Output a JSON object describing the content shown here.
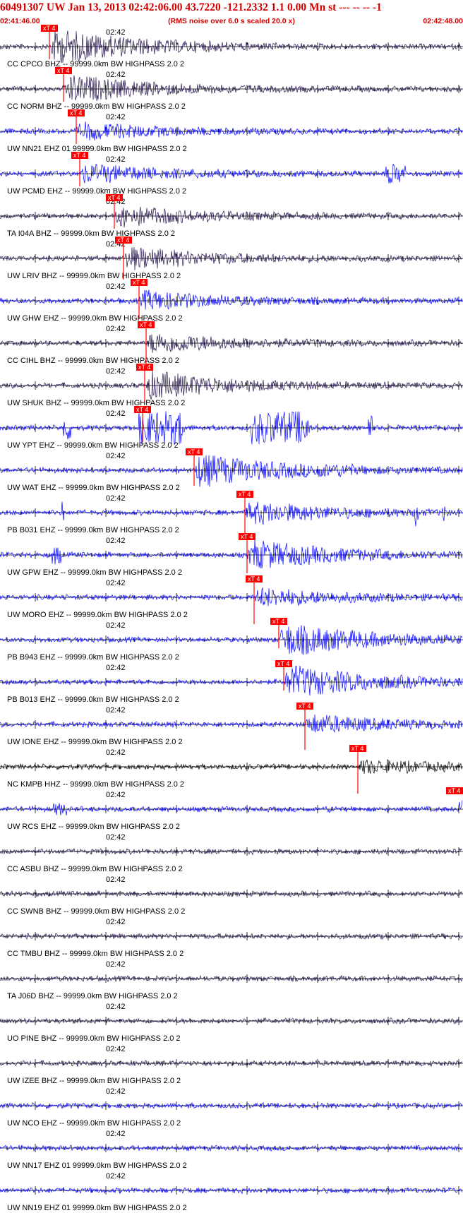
{
  "header": {
    "title": "60491307 UW Jan 13, 2013 02:42:06.00   43.7220 -121.2332  1.1 0.00 Mn st --- -- --  -1",
    "subtitle": "(RMS noise over 6.0 s scaled 20.0 x)",
    "start_time": "02:41:46.00",
    "end_time": "02:42:48.00",
    "title_color": "#d40000"
  },
  "tick_label": "02:42",
  "pick_label": "xT 4",
  "colors": {
    "pick": "#ff0000",
    "blue": "#0000ff",
    "dark": "#21104a",
    "black": "#000000"
  },
  "channels": [
    {
      "label": "CC CPCO BHZ -- 99999.0km BW  HIGHPASS  2.0  2",
      "color": "dark"
    },
    {
      "label": "CC NORM BHZ -- 99999.0km BW  HIGHPASS  2.0  2",
      "color": "dark"
    },
    {
      "label": "UW NN21 EHZ 01 99999.0km BW  HIGHPASS  2.0  2",
      "color": "blue"
    },
    {
      "label": "UW PCMD EHZ -- 99999.0km BW  HIGHPASS  2.0  2",
      "color": "blue"
    },
    {
      "label": "TA I04A BHZ -- 99999.0km BW  HIGHPASS  2.0  2",
      "color": "dark"
    },
    {
      "label": "UW LRIV BHZ -- 99999.0km BW  HIGHPASS  2.0  2",
      "color": "dark"
    },
    {
      "label": "UW GHW EHZ -- 99999.0km BW  HIGHPASS  2.0  2",
      "color": "blue"
    },
    {
      "label": "CC CIHL BHZ -- 99999.0km BW  HIGHPASS  2.0  2",
      "color": "dark"
    },
    {
      "label": "UW SHUK BHZ -- 99999.0km BW  HIGHPASS  2.0  2",
      "color": "dark"
    },
    {
      "label": "UW YPT EHZ -- 99999.0km BW  HIGHPASS  2.0  2",
      "color": "blue"
    },
    {
      "label": "UW WAT EHZ -- 99999.0km BW  HIGHPASS  2.0  2",
      "color": "blue"
    },
    {
      "label": "PB B031 EHZ -- 99999.0km BW  HIGHPASS  2.0  2",
      "color": "blue"
    },
    {
      "label": "UW GPW EHZ -- 99999.0km BW  HIGHPASS  2.0  2",
      "color": "blue"
    },
    {
      "label": "UW MORO EHZ -- 99999.0km BW  HIGHPASS  2.0  2",
      "color": "blue"
    },
    {
      "label": "PB B943 EHZ -- 99999.0km BW  HIGHPASS  2.0  2",
      "color": "blue"
    },
    {
      "label": "PB B013 EHZ -- 99999.0km BW  HIGHPASS  2.0  2",
      "color": "blue"
    },
    {
      "label": "UW IONE EHZ -- 99999.0km BW  HIGHPASS  2.0  2",
      "color": "blue"
    },
    {
      "label": "NC KMPB HHZ -- 99999.0km BW  HIGHPASS  2.0  2",
      "color": "black"
    },
    {
      "label": "UW RCS EHZ -- 99999.0km BW  HIGHPASS  2.0  2",
      "color": "blue"
    },
    {
      "label": "CC ASBU BHZ -- 99999.0km BW  HIGHPASS  2.0  2",
      "color": "dark"
    },
    {
      "label": "CC SWNB BHZ -- 99999.0km BW  HIGHPASS  2.0  2",
      "color": "dark"
    },
    {
      "label": "CC TMBU BHZ -- 99999.0km BW  HIGHPASS  2.0  2",
      "color": "dark"
    },
    {
      "label": "TA J06D BHZ -- 99999.0km BW  HIGHPASS  2.0  2",
      "color": "dark"
    },
    {
      "label": "UO PINE BHZ -- 99999.0km BW  HIGHPASS  2.0  2",
      "color": "dark"
    },
    {
      "label": "UW IZEE BHZ -- 99999.0km BW  HIGHPASS  2.0  2",
      "color": "dark"
    },
    {
      "label": "UW NCO EHZ -- 99999.0km BW  HIGHPASS  2.0  2",
      "color": "blue"
    },
    {
      "label": "UW NN17 EHZ 01 99999.0km BW  HIGHPASS  2.0  2",
      "color": "blue"
    },
    {
      "label": "UW NN19 EHZ 01 99999.0km BW  HIGHPASS  2.0  2",
      "color": "blue"
    }
  ]
}
